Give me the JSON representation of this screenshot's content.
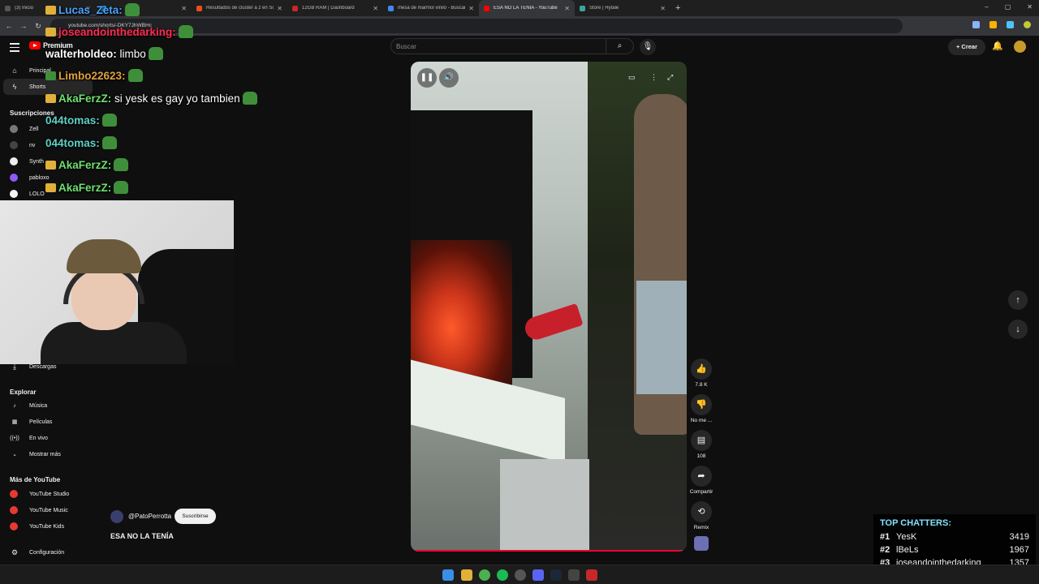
{
  "browser": {
    "tabs": [
      {
        "title": "(3) Inicio",
        "color": "#555555",
        "active": false
      },
      {
        "title": "",
        "color": "#1da1f2",
        "active": false
      },
      {
        "title": "Resultados de cluster a z en So",
        "color": "#e94e1b",
        "active": false
      },
      {
        "title": "12GB RAM | Dashboard",
        "color": "#c62828",
        "active": false
      },
      {
        "title": "mesa de marmol vinilo - Buscar",
        "color": "#4285f4",
        "active": false
      },
      {
        "title": "ESA NO LA TENÍA - YouTube",
        "color": "#ff0000",
        "active": true
      },
      {
        "title": "Store | Hytale",
        "color": "#3aa6a0",
        "active": false
      }
    ],
    "url": "youtube.com/shorts/-DKY7JhWBHc"
  },
  "youtube": {
    "logo_text": "Premium",
    "search_placeholder": "Buscar",
    "create_label": "Crear",
    "sidebar": {
      "top_items": [
        {
          "label": "Principal",
          "icon": "home-icon"
        },
        {
          "label": "Shorts",
          "icon": "shorts-icon"
        }
      ],
      "subs_heading": "Suscripciones",
      "subs": [
        {
          "label": "Zell",
          "color": "#777777"
        },
        {
          "label": "nv",
          "color": "#444444"
        },
        {
          "label": "Synth",
          "color": "#eeeeee"
        },
        {
          "label": "pabloxo",
          "color": "#8b5cf6"
        },
        {
          "label": "LOLO",
          "color": "#f5f5f5"
        }
      ],
      "downloads_label": "Descargas",
      "explore_heading": "Explorar",
      "explore": [
        {
          "label": "Música",
          "icon": "music-icon"
        },
        {
          "label": "Películas",
          "icon": "film-icon"
        },
        {
          "label": "En vivo",
          "icon": "live-icon"
        },
        {
          "label": "Mostrar más",
          "icon": "chevron-down-icon"
        }
      ],
      "more_heading": "Más de YouTube",
      "more": [
        {
          "label": "YouTube Studio"
        },
        {
          "label": "YouTube Music"
        },
        {
          "label": "YouTube Kids"
        }
      ],
      "settings_label": "Configuración"
    },
    "short": {
      "channel": "@PatoPerrotta",
      "subscribe_label": "Suscribirse",
      "title": "ESA NO LA TENÍA",
      "progress": 0.98,
      "actions": {
        "like_count": "7.8 K",
        "dislike_label": "No me ...",
        "comments_count": "108",
        "share_label": "Compartir",
        "remix_label": "Remix"
      }
    }
  },
  "stream_overlay": {
    "chat": [
      {
        "user": "Lucas_Zeta:",
        "msg": "",
        "color": "#4aa3ff"
      },
      {
        "user": "joseandointhedarking:",
        "msg": "",
        "color": "#ff2a4d"
      },
      {
        "user": "walterholdeo:",
        "msg": " limbo",
        "color": "#ffffff"
      },
      {
        "user": "Limbo22623:",
        "msg": "",
        "color": "#e0a13a"
      },
      {
        "user": "AkaFerzZ:",
        "msg": " si yesk es gay yo tambien",
        "color": "#6fe06f"
      },
      {
        "user": "044tomas:",
        "msg": "",
        "color": "#5fd1c7"
      },
      {
        "user": "044tomas:",
        "msg": "",
        "color": "#5fd1c7"
      },
      {
        "user": "AkaFerzZ:",
        "msg": "",
        "color": "#6fe06f"
      },
      {
        "user": "AkaFerzZ:",
        "msg": "",
        "color": "#6fe06f"
      }
    ],
    "top_chatters": {
      "heading": "TOP CHATTERS:",
      "rows": [
        {
          "rank": "#1",
          "name": "YesK",
          "count": "3419"
        },
        {
          "rank": "#2",
          "name": "lBeLs",
          "count": "1967"
        },
        {
          "rank": "#3",
          "name": "joseandointhedarking",
          "count": "1357"
        }
      ]
    }
  }
}
